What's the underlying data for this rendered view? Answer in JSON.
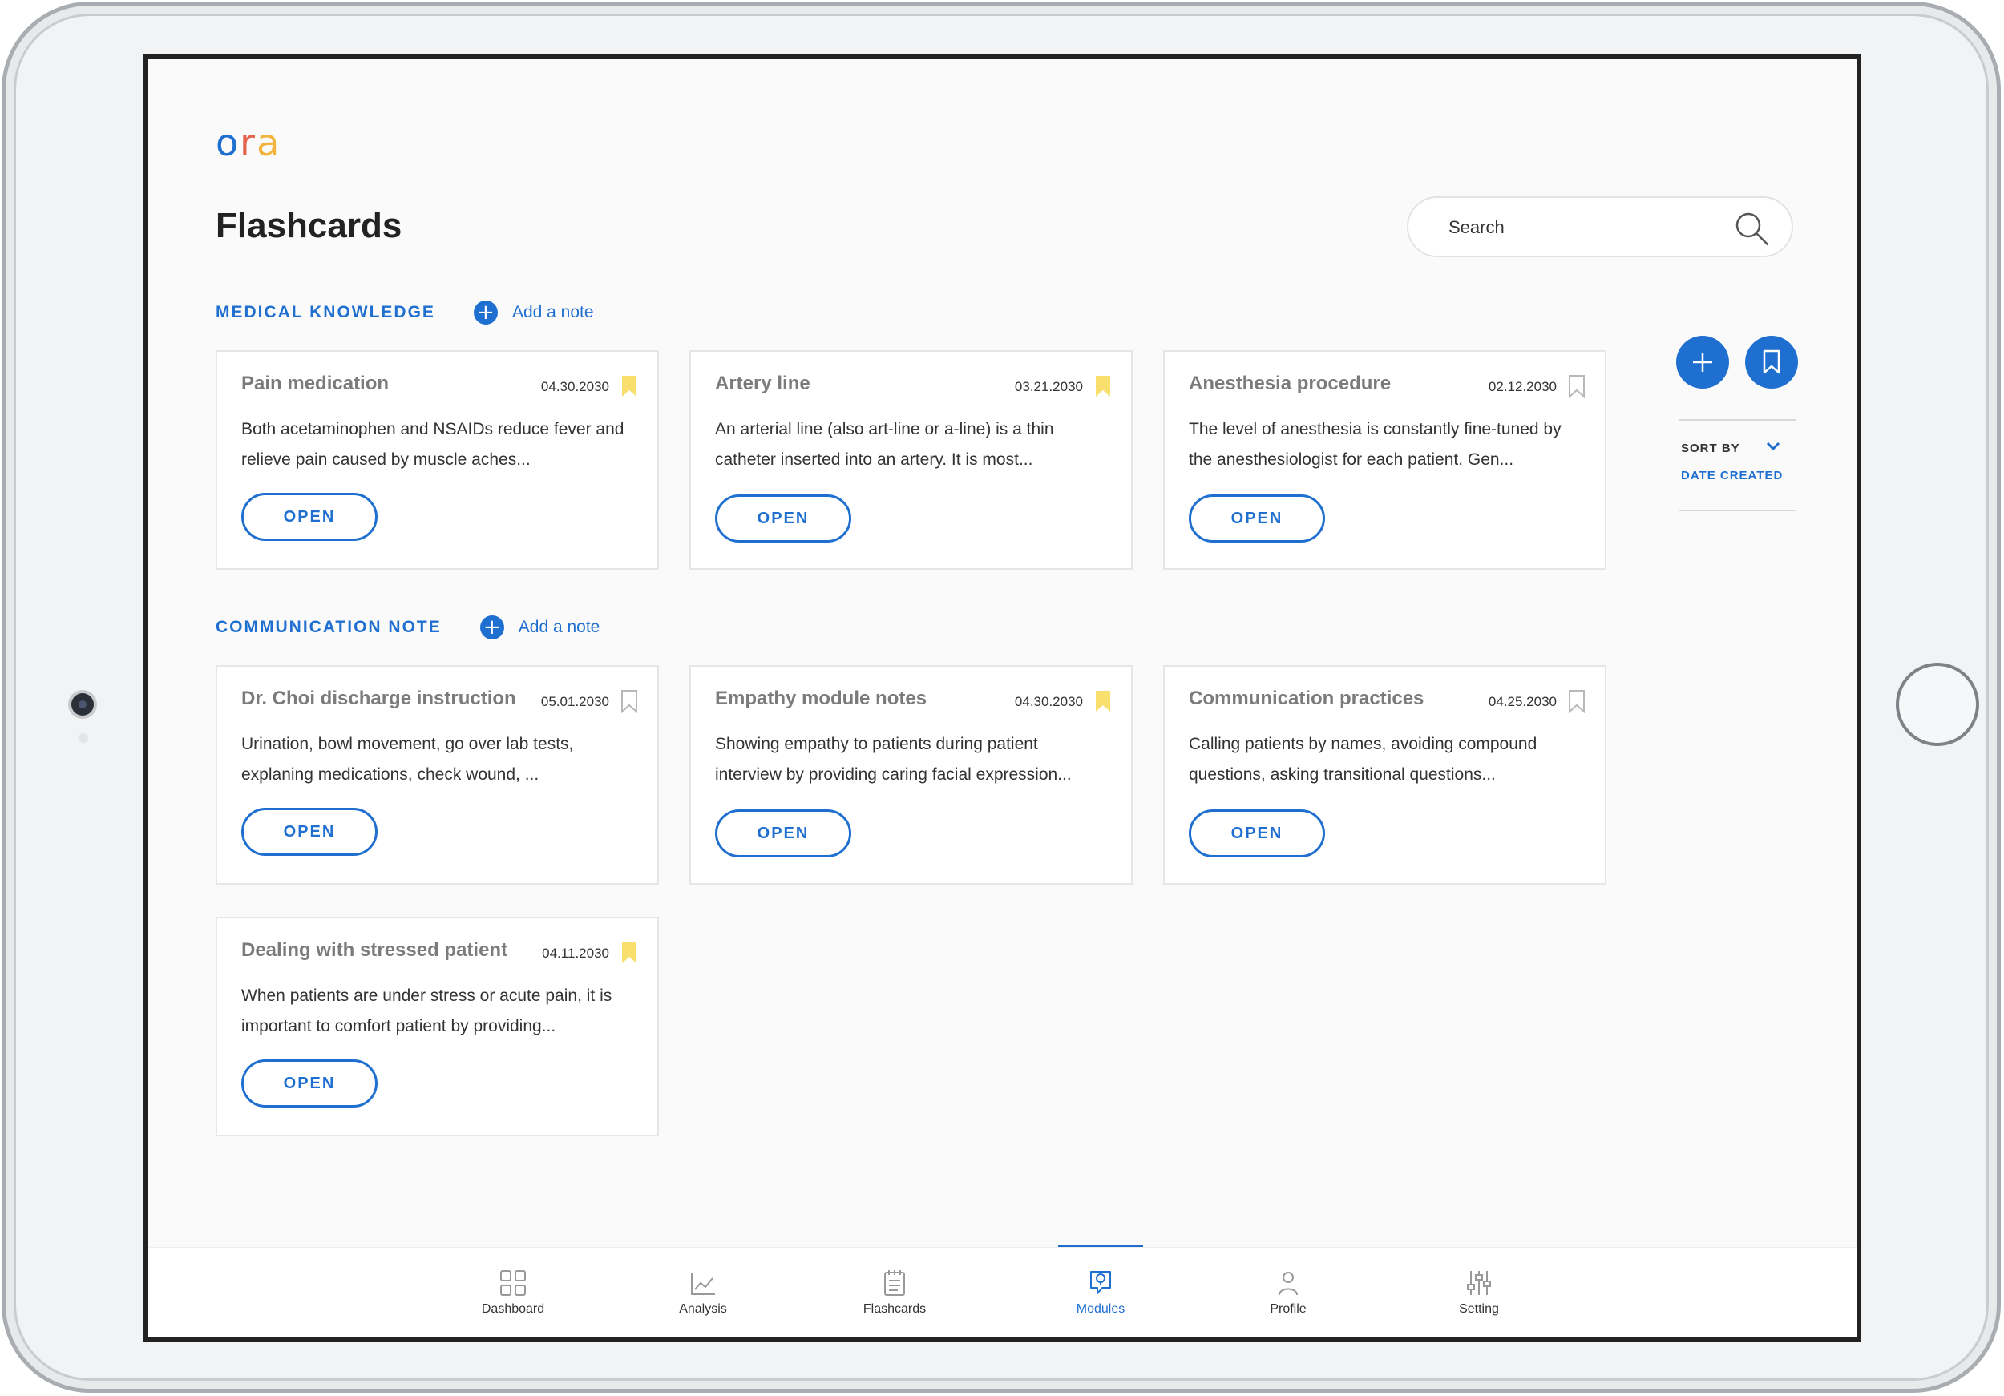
{
  "app": {
    "logo_o": "o",
    "logo_r": "r",
    "logo_a": "a"
  },
  "page": {
    "title": "Flashcards"
  },
  "search": {
    "placeholder": "Search",
    "value": ""
  },
  "sections": [
    {
      "title": "MEDICAL KNOWLEDGE",
      "add_label": "Add a note",
      "cards": [
        {
          "title": "Pain medication",
          "date": "04.30.2030",
          "bookmarked": true,
          "body": "Both acetaminophen and NSAIDs reduce fever and relieve pain caused by muscle aches...",
          "button": "OPEN"
        },
        {
          "title": "Artery line",
          "date": "03.21.2030",
          "bookmarked": true,
          "body": "An arterial line (also art-line or a-line) is a thin catheter inserted into an artery. It is most...",
          "button": "OPEN"
        },
        {
          "title": "Anesthesia procedure",
          "date": "02.12.2030",
          "bookmarked": false,
          "body": "The level of anesthesia is constantly fine-tuned by the anesthesiologist for each patient. Gen...",
          "button": "OPEN"
        }
      ]
    },
    {
      "title": "COMMUNICATION NOTE",
      "add_label": "Add a note",
      "cards": [
        {
          "title": "Dr. Choi discharge instruction",
          "date": "05.01.2030",
          "bookmarked": false,
          "body": "Urination, bowl movement, go over lab tests, explaning medications, check wound, ...",
          "button": "OPEN"
        },
        {
          "title": "Empathy module notes",
          "date": "04.30.2030",
          "bookmarked": true,
          "body": "Showing empathy to patients during patient interview by providing caring facial expression...",
          "button": "OPEN"
        },
        {
          "title": "Communication practices",
          "date": "04.25.2030",
          "bookmarked": false,
          "body": "Calling patients by names, avoiding compound questions, asking transitional questions...",
          "button": "OPEN"
        },
        {
          "title": "Dealing with stressed patient",
          "date": "04.11.2030",
          "bookmarked": true,
          "body": "When patients are under stress or acute pain, it is important to comfort patient by providing...",
          "button": "OPEN"
        }
      ]
    }
  ],
  "sort": {
    "label": "SORT BY",
    "value": "DATE CREATED"
  },
  "nav": [
    {
      "label": "Dashboard",
      "icon": "grid-icon",
      "active": false
    },
    {
      "label": "Analysis",
      "icon": "line-chart-icon",
      "active": false
    },
    {
      "label": "Flashcards",
      "icon": "notepad-icon",
      "active": false
    },
    {
      "label": "Modules",
      "icon": "lightbulb-chat-icon",
      "active": true
    },
    {
      "label": "Profile",
      "icon": "person-icon",
      "active": false
    },
    {
      "label": "Setting",
      "icon": "sliders-icon",
      "active": false
    }
  ],
  "colors": {
    "accent": "#1f6fd1",
    "bookmark_on": "#f8df6e",
    "bookmark_off": "#b8b8b8"
  }
}
